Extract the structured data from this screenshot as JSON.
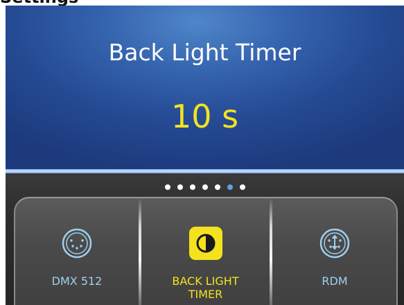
{
  "page_header": {
    "text": "Settings"
  },
  "display": {
    "title": "Back Light Timer",
    "value": "10 s"
  },
  "pagination": {
    "total": 7,
    "active_index": 5
  },
  "menu": {
    "items": [
      {
        "label": "DMX 512",
        "icon": "dmx-connector-icon",
        "selected": false
      },
      {
        "label": "BACK LIGHT TIMER",
        "icon": "contrast-icon",
        "selected": true
      },
      {
        "label": "RDM",
        "icon": "rdm-connector-icon",
        "selected": false
      }
    ]
  },
  "colors": {
    "value_yellow": "#f5e21f",
    "label_blue": "#9fd0f0",
    "active_dot": "#5ea0e6",
    "display_blue": "#3462ad"
  }
}
